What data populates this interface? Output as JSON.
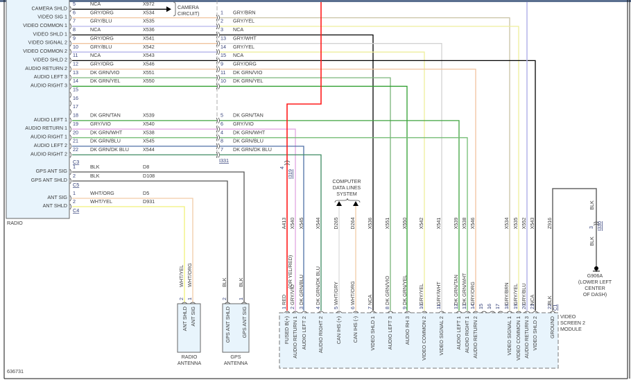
{
  "figure_id": "636731",
  "wire_colors": {
    "NCA": "#000000",
    "BLK": "#555555",
    "GRY/ORG": "#f0c39e",
    "GRY/BLU": "#b4b4ea",
    "GRY/BRN": "#c9c2a4",
    "GRY/YEL": "#eeee9c",
    "GRY/WHT": "#d2d2d2",
    "DK GRN/VIO": "#78b478",
    "DK GRN/YEL": "#2e9e2e",
    "DK GRN/TAN": "#3ea33e",
    "GRY/VIO": "#e2a6e2",
    "DK GRN/WHT": "#72bc72",
    "DK GRN/BLU": "#4f6fa6",
    "DK GRN/DK BLU": "#3d8a60",
    "RED": "#ff1a1a",
    "WHT/GRY": "#dcdcdc",
    "WHT/ORG": "#f2cba8",
    "WHT/YEL": "#f0f07a",
    "module_fill": "#e8f4fc"
  },
  "radio": {
    "label": "RADIO",
    "c3": {
      "name": "C3",
      "pins": [
        {
          "pin": "5",
          "func": "CAMERA SHLD",
          "color": "NCA",
          "circuit": "X972"
        },
        {
          "pin": "6",
          "func": "VIDEO SIG 1",
          "color": "GRY/ORG",
          "circuit": "X534"
        },
        {
          "pin": "7",
          "func": "VIDEO COMMON 1",
          "color": "GRY/BLU",
          "circuit": "X535"
        },
        {
          "pin": "8",
          "func": "VIDEO SHLD 1",
          "color": "NCA",
          "circuit": "X536"
        },
        {
          "pin": "9",
          "func": "VIDEO SIGNAL 2",
          "color": "GRY/ORG",
          "circuit": "X541"
        },
        {
          "pin": "10",
          "func": "VIDEO COMMON 2",
          "color": "GRY/BLU",
          "circuit": "X542"
        },
        {
          "pin": "11",
          "func": "VIDEO SHLD 2",
          "color": "NCA",
          "circuit": "X543"
        },
        {
          "pin": "12",
          "func": "AUDIO RETURN 2",
          "color": "GRY/ORG",
          "circuit": "X546"
        },
        {
          "pin": "13",
          "func": "AUDIO LEFT 3",
          "color": "DK GRN/VIO",
          "circuit": "X551"
        },
        {
          "pin": "14",
          "func": "AUDIO RIGHT 3",
          "color": "DK GRN/YEL",
          "circuit": "X550"
        },
        {
          "pin": "15",
          "func": "",
          "color": "",
          "circuit": ""
        },
        {
          "pin": "16",
          "func": "",
          "color": "",
          "circuit": ""
        },
        {
          "pin": "17",
          "func": "",
          "color": "",
          "circuit": ""
        },
        {
          "pin": "18",
          "func": "AUDIO LEFT 1",
          "color": "DK GRN/TAN",
          "circuit": "X539"
        },
        {
          "pin": "19",
          "func": "AUDIO RETURN 1",
          "color": "GRY/VIO",
          "circuit": "X540"
        },
        {
          "pin": "20",
          "func": "AUDIO RIGHT 1",
          "color": "DK GRN/WHT",
          "circuit": "X538"
        },
        {
          "pin": "21",
          "func": "AUDIO LEFT 2",
          "color": "DK GRN/BLU",
          "circuit": "X545"
        },
        {
          "pin": "22",
          "func": "AUDIO RIGHT 2",
          "color": "DK GRN/DK BLU",
          "circuit": "X544"
        }
      ]
    },
    "c5": {
      "name": "C5",
      "pins": [
        {
          "pin": "1",
          "func": "GPS ANT SIG",
          "color": "BLK",
          "circuit": "D8"
        },
        {
          "pin": "2",
          "func": "GPS ANT SHLD",
          "color": "BLK",
          "circuit": "D108"
        }
      ]
    },
    "c4": {
      "name": "C4",
      "pins": [
        {
          "pin": "1",
          "func": "ANT SIG",
          "color": "WHT/ORG",
          "circuit": "D5"
        },
        {
          "pin": "2",
          "func": "ANT SHLD",
          "color": "WHT/YEL",
          "circuit": "D931"
        }
      ]
    }
  },
  "camera_label": [
    "CAMERA",
    "CIRCUIT)"
  ],
  "i331": {
    "name": "I331",
    "pins": [
      {
        "row": "6",
        "pin": "1",
        "color": "GRY/BRN"
      },
      {
        "row": "7",
        "pin": "2",
        "color": "GRY/YEL"
      },
      {
        "row": "8",
        "pin": "3",
        "color": "NCA"
      },
      {
        "row": "9",
        "pin": "13",
        "color": "GRY/WHT"
      },
      {
        "row": "10",
        "pin": "14",
        "color": "GRY/YEL"
      },
      {
        "row": "11",
        "pin": "15",
        "color": "NCA"
      },
      {
        "row": "12",
        "pin": "9",
        "color": "GRY/ORG"
      },
      {
        "row": "13",
        "pin": "11",
        "color": "DK GRN/VIO"
      },
      {
        "row": "14",
        "pin": "10",
        "color": "DK GRN/YEL"
      },
      {
        "row": "18",
        "pin": "5",
        "color": "DK GRN/TAN"
      },
      {
        "row": "19",
        "pin": "6",
        "color": "GRY/VIO"
      },
      {
        "row": "20",
        "pin": "4",
        "color": "DK GRN/WHT"
      },
      {
        "row": "21",
        "pin": "8",
        "color": "DK GRN/BLU"
      },
      {
        "row": "22",
        "pin": "7",
        "color": "DK GRN/DK BLU"
      }
    ]
  },
  "i319": {
    "name": "I319",
    "pin": "4"
  },
  "i330": {
    "name": "I330",
    "pin": "3",
    "color_above": "BLK",
    "color_below": "BLK"
  },
  "ground": {
    "name": "G906A",
    "location": [
      "(LOWER LEFT",
      "CENTER",
      "OF DASH)"
    ]
  },
  "data_lines": {
    "label": [
      "COMPUTER",
      "DATA LINES",
      "SYSTEM"
    ]
  },
  "module": {
    "name": [
      "VIDEO",
      "SCREEN 2",
      "MODULE"
    ],
    "connector": "C1",
    "red_alt": "(OR YEL/RED)",
    "pins": [
      {
        "pin": "1",
        "func": "FUSED B(+)",
        "color": "RED",
        "circuit": "A413"
      },
      {
        "pin": "2",
        "func": "AUDIO RETURN 1",
        "color": "GRY/VIO",
        "circuit": "X540"
      },
      {
        "pin": "3",
        "func": "AUDIO LEFT 2",
        "color": "DK GRN/BLU",
        "circuit": "X545"
      },
      {
        "pin": "4",
        "func": "AUDIO RIGHT 2",
        "color": "DK GRN/DK BLU",
        "circuit": "X544"
      },
      {
        "pin": "5",
        "func": "CAN IHS (+)",
        "color": "WHT/GRY",
        "circuit": "D265"
      },
      {
        "pin": "6",
        "func": "CAN IHS (-)",
        "color": "WHT/ORG",
        "circuit": "D264"
      },
      {
        "pin": "7",
        "func": "VIDEO SHLD 1",
        "color": "NCA",
        "circuit": "X536"
      },
      {
        "pin": "8",
        "func": "AUDIO LEFT 3",
        "color": "DK GRN/VIO",
        "circuit": "X551"
      },
      {
        "pin": "9",
        "func": "AUDIO RH 3",
        "color": "DK GRN/YEL",
        "circuit": "X550"
      },
      {
        "pin": "10",
        "func": "VIDEO COMMON 2",
        "color": "GRY/YEL",
        "circuit": "X542"
      },
      {
        "pin": "11",
        "func": "VIDEO SIGNAL 2",
        "color": "GRY/WHT",
        "circuit": "X541"
      },
      {
        "pin": "12",
        "func": "AUDIO LEFT 1",
        "color": "DK GRN/TAN",
        "circuit": "X539"
      },
      {
        "pin": "13",
        "func": "AUDIO RIGHT 1",
        "color": "DK GRN/WHT",
        "circuit": "X538"
      },
      {
        "pin": "14",
        "func": "AUDIO RETURN 2",
        "color": "GRY/ORG",
        "circuit": "X546"
      },
      {
        "pin": "15",
        "func": "",
        "color": "",
        "circuit": ""
      },
      {
        "pin": "16",
        "func": "",
        "color": "",
        "circuit": ""
      },
      {
        "pin": "17",
        "func": "",
        "color": "",
        "circuit": ""
      },
      {
        "pin": "18",
        "func": "VIDEO SIGNAL 1",
        "color": "GRY/BRN",
        "circuit": "X534"
      },
      {
        "pin": "19",
        "func": "VIDEO COMMON 1",
        "color": "GRY/YEL",
        "circuit": "X535"
      },
      {
        "pin": "20",
        "func": "AUDIO RETURN 3",
        "color": "GRY/BLU",
        "circuit": "X552"
      },
      {
        "pin": "21",
        "func": "VIDEO SHLD 2",
        "color": "NCA",
        "circuit": "X543"
      },
      {
        "pin": "22",
        "func": "GROUND",
        "color": "BLK",
        "circuit": "Z916"
      }
    ]
  },
  "radio_antenna": {
    "name": [
      "RADIO",
      "ANTENNA"
    ],
    "pins": [
      {
        "pin": "2",
        "func": "ANT SHLD",
        "color": "WHT/YEL"
      },
      {
        "pin": "1",
        "func": "ANT SIG",
        "color": "WHT/ORG"
      }
    ]
  },
  "gps_antenna": {
    "name": [
      "GPS",
      "ANTENNA"
    ],
    "pins": [
      {
        "pin": "2",
        "func": "GPS ANT SHLD",
        "color": "BLK"
      },
      {
        "pin": "1",
        "func": "GPS ANT SIG",
        "color": "BLK"
      }
    ]
  }
}
